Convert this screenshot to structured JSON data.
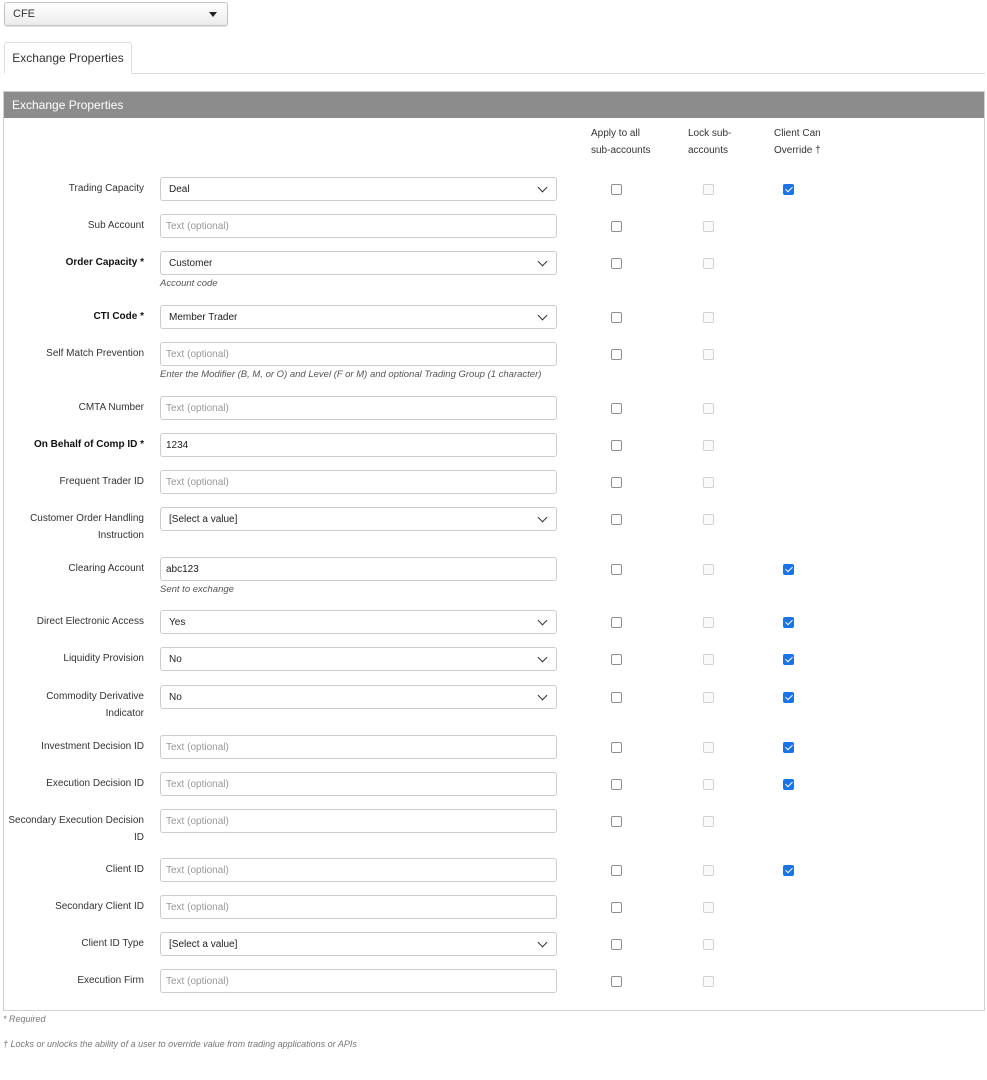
{
  "exchange_select": {
    "value": "CFE"
  },
  "tabs": [
    {
      "label": "Exchange Properties"
    }
  ],
  "panel": {
    "title": "Exchange Properties"
  },
  "columns": {
    "apply": [
      "Apply to all",
      "sub-accounts"
    ],
    "lock": [
      "Lock sub-",
      "accounts"
    ],
    "override": [
      "Client Can",
      "Override †"
    ]
  },
  "rows": [
    {
      "label": "Trading Capacity",
      "required": false,
      "type": "select",
      "value": "Deal",
      "hint": "",
      "apply": false,
      "override": true
    },
    {
      "label": "Sub Account",
      "required": false,
      "type": "input",
      "value": "",
      "placeholder": "Text (optional)",
      "hint": "",
      "apply": false,
      "override": null
    },
    {
      "label": "Order Capacity *",
      "required": true,
      "type": "select",
      "value": "Customer",
      "hint": "Account code",
      "apply": false,
      "override": null
    },
    {
      "label": "CTI Code *",
      "required": true,
      "type": "select",
      "value": "Member Trader",
      "hint": "",
      "apply": false,
      "override": null
    },
    {
      "label": "Self Match Prevention",
      "required": false,
      "type": "input",
      "value": "",
      "placeholder": "Text (optional)",
      "hint": "Enter the Modifier (B, M, or O) and Level (F or M) and optional Trading Group (1 character)",
      "apply": false,
      "override": null
    },
    {
      "label": "CMTA Number",
      "required": false,
      "type": "input",
      "value": "",
      "placeholder": "Text (optional)",
      "hint": "",
      "apply": false,
      "override": null
    },
    {
      "label": "On Behalf of Comp ID *",
      "required": true,
      "type": "input",
      "value": "1234",
      "placeholder": "",
      "hint": "",
      "apply": false,
      "override": null
    },
    {
      "label": "Frequent Trader ID",
      "required": false,
      "type": "input",
      "value": "",
      "placeholder": "Text (optional)",
      "hint": "",
      "apply": false,
      "override": null
    },
    {
      "label": "Customer Order Handling Instruction",
      "required": false,
      "type": "select",
      "value": "[Select a value]",
      "hint": "",
      "apply": false,
      "override": null
    },
    {
      "label": "Clearing Account",
      "required": false,
      "type": "input",
      "value": "abc123",
      "placeholder": "",
      "hint": "Sent to exchange",
      "apply": false,
      "override": true
    },
    {
      "label": "Direct Electronic Access",
      "required": false,
      "type": "select",
      "value": "Yes",
      "hint": "",
      "apply": false,
      "override": true
    },
    {
      "label": "Liquidity Provision",
      "required": false,
      "type": "select",
      "value": "No",
      "hint": "",
      "apply": false,
      "override": true
    },
    {
      "label": "Commodity Derivative Indicator",
      "required": false,
      "type": "select",
      "value": "No",
      "hint": "",
      "apply": false,
      "override": true
    },
    {
      "label": "Investment Decision ID",
      "required": false,
      "type": "input",
      "value": "",
      "placeholder": "Text (optional)",
      "hint": "",
      "apply": false,
      "override": true
    },
    {
      "label": "Execution Decision ID",
      "required": false,
      "type": "input",
      "value": "",
      "placeholder": "Text (optional)",
      "hint": "",
      "apply": false,
      "override": true
    },
    {
      "label": "Secondary Execution Decision ID",
      "required": false,
      "type": "input",
      "value": "",
      "placeholder": "Text (optional)",
      "hint": "",
      "apply": false,
      "override": null
    },
    {
      "label": "Client ID",
      "required": false,
      "type": "input",
      "value": "",
      "placeholder": "Text (optional)",
      "hint": "",
      "apply": false,
      "override": true
    },
    {
      "label": "Secondary Client ID",
      "required": false,
      "type": "input",
      "value": "",
      "placeholder": "Text (optional)",
      "hint": "",
      "apply": false,
      "override": null
    },
    {
      "label": "Client ID Type",
      "required": false,
      "type": "select",
      "value": "[Select a value]",
      "hint": "",
      "apply": false,
      "override": null
    },
    {
      "label": "Execution Firm",
      "required": false,
      "type": "input",
      "value": "",
      "placeholder": "Text (optional)",
      "hint": "",
      "apply": false,
      "override": null
    }
  ],
  "footnotes": {
    "required": "* Required",
    "override": "† Locks or unlocks the ability of a user to override value from trading applications or APIs"
  },
  "colors": {
    "header_bg": "#8c8c8c",
    "checkbox_checked": "#1a73e8"
  }
}
